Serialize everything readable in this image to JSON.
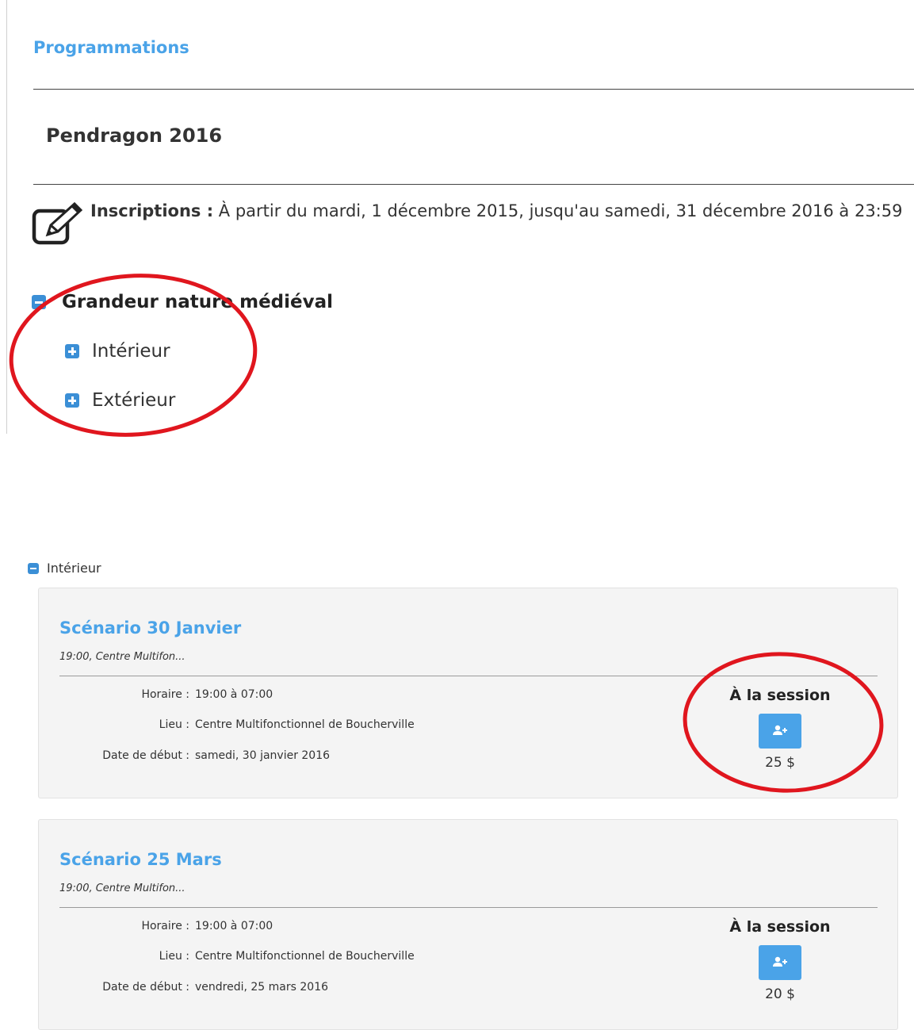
{
  "header": {
    "section_title": "Programmations"
  },
  "program": {
    "title": "Pendragon 2016",
    "inscriptions_label": "Inscriptions :",
    "inscriptions_text": " À partir du mardi, 1 décembre 2015, jusqu'au samedi, 31 décembre 2016 à 23:59"
  },
  "tree": {
    "category": "Grandeur nature médiéval",
    "subs": [
      "Intérieur",
      "Extérieur"
    ]
  },
  "expanded": {
    "label": "Intérieur",
    "sessions": [
      {
        "title": "Scénario 30 Janvier",
        "summary": "19:00, Centre Multifon...",
        "horaire_label": "Horaire :",
        "horaire": "19:00 à 07:00",
        "lieu_label": "Lieu :",
        "lieu": "Centre Multifonctionnel de Boucherville",
        "date_label": "Date de début :",
        "date": "samedi, 30 janvier 2016",
        "session_label": "À la session",
        "price": "25 $"
      },
      {
        "title": "Scénario 25 Mars",
        "summary": "19:00, Centre Multifon...",
        "horaire_label": "Horaire :",
        "horaire": "19:00 à 07:00",
        "lieu_label": "Lieu :",
        "lieu": "Centre Multifonctionnel de Boucherville",
        "date_label": "Date de début :",
        "date": "vendredi, 25 mars 2016",
        "session_label": "À la session",
        "price": "20 $"
      }
    ]
  },
  "icons": {
    "edit": "edit-icon",
    "expand": "plus-square-icon",
    "collapse": "minus-square-icon",
    "register": "user-add-icon"
  },
  "colors": {
    "link_blue": "#4aa3e8",
    "toggle_blue": "#3b8fd6",
    "annotation_red": "#e0161e",
    "card_bg": "#f4f4f4"
  }
}
